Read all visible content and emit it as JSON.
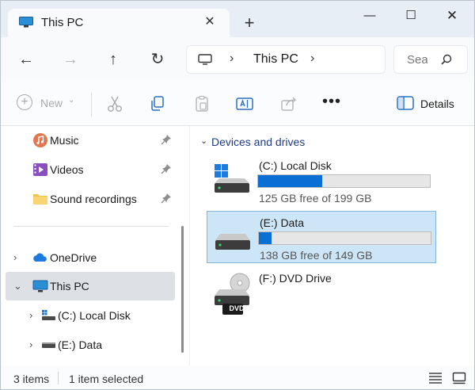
{
  "tab": {
    "title": "This PC",
    "close_glyph": "✕",
    "new_tab_glyph": "+"
  },
  "window_controls": {
    "minimize": "—",
    "maximize": "☐",
    "close": "✕"
  },
  "nav": {
    "back": "←",
    "forward": "→",
    "up": "↑",
    "refresh": "↻"
  },
  "address": {
    "chevron": "›",
    "segment": "This PC"
  },
  "search": {
    "placeholder": "Search This PC"
  },
  "commands": {
    "new_label": "New",
    "new_glyph": "+",
    "new_dropdown": "⌄",
    "more_glyph": "•••",
    "details_label": "Details"
  },
  "sidebar": {
    "quick_access": [
      {
        "label": "Music",
        "icon": "music-icon",
        "pinned": true
      },
      {
        "label": "Videos",
        "icon": "videos-icon",
        "pinned": true
      },
      {
        "label": "Sound recordings",
        "icon": "folder-icon",
        "pinned": true
      }
    ],
    "tree": [
      {
        "label": "OneDrive",
        "icon": "onedrive-icon",
        "chevron": "›"
      },
      {
        "label": "This PC",
        "icon": "this-pc-icon",
        "chevron": "⌄",
        "selected": true
      },
      {
        "label": "(C:) Local Disk",
        "icon": "local-disk-icon",
        "chevron": "›"
      },
      {
        "label": "(E:) Data",
        "icon": "drive-icon",
        "chevron": "›"
      }
    ]
  },
  "content": {
    "group_chevron": "⌄",
    "group_title": "Devices and drives",
    "drives": [
      {
        "name": "(C:) Local Disk",
        "free_text": "125 GB free of 199 GB",
        "used_fraction": 0.372,
        "selected": false
      },
      {
        "name": "(E:) Data",
        "free_text": "138 GB free of 149 GB",
        "used_fraction": 0.074,
        "selected": true
      },
      {
        "name": "(F:) DVD Drive",
        "badge": "DVD",
        "selected": false
      }
    ]
  },
  "status": {
    "item_count": "3 items",
    "selection": "1 item selected"
  },
  "colors": {
    "accent": "#0a6fd4",
    "selected_bg": "#cde6f7",
    "group_header": "#1f3b8a"
  }
}
